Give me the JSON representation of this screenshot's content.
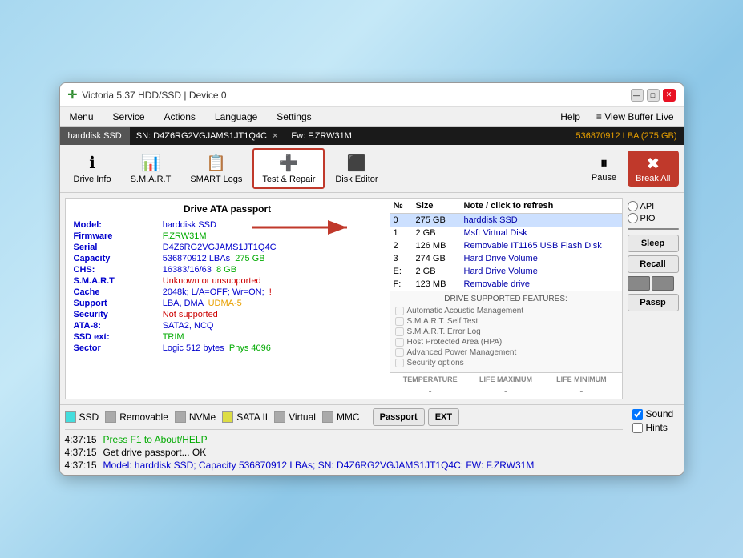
{
  "window": {
    "title": "Victoria 5.37 HDD/SSD | Device 0",
    "icon": "✛"
  },
  "titlebar_controls": {
    "minimize": "—",
    "maximize": "□",
    "close": "✕"
  },
  "menubar": {
    "items": [
      "Menu",
      "Service",
      "Actions",
      "Language",
      "Settings",
      "Help"
    ],
    "right_items": [
      "≡ View Buffer Live"
    ]
  },
  "device_bar": {
    "device_label": "harddisk SSD",
    "sn_label": "SN: D4Z6RG2VGJAMS1JT1Q4C",
    "fw_label": "Fw: F.ZRW31M",
    "lba_label": "536870912 LBA (275 GB)"
  },
  "toolbar": {
    "buttons": [
      {
        "id": "drive-info",
        "icon": "ℹ",
        "label": "Drive Info"
      },
      {
        "id": "smart",
        "icon": "📊",
        "label": "S.M.A.R.T"
      },
      {
        "id": "smart-logs",
        "icon": "📋",
        "label": "SMART Logs"
      },
      {
        "id": "test-repair",
        "icon": "➕",
        "label": "Test & Repair",
        "active": true
      },
      {
        "id": "disk-editor",
        "icon": "⬛",
        "label": "Disk Editor"
      }
    ],
    "pause_label": "Pause",
    "break_label": "Break All"
  },
  "left_panel": {
    "title": "Drive ATA passport",
    "rows": [
      {
        "label": "Model:",
        "value": "harddisk SSD",
        "value_class": "val-blue"
      },
      {
        "label": "Firmware",
        "value": "F.ZRW31M",
        "value_class": "val-green"
      },
      {
        "label": "Serial",
        "value": "D4Z6RG2VGJAMS1JT1Q4C",
        "value_class": "val-blue"
      },
      {
        "label": "Capacity",
        "value": "536870912 LBAs",
        "value_class": "val-blue",
        "extra": "275 GB",
        "extra_class": "val-green"
      },
      {
        "label": "CHS:",
        "value": "16383/16/63",
        "value_class": "val-blue",
        "extra": "8 GB",
        "extra_class": "val-green"
      },
      {
        "label": "S.M.A.R.T",
        "value": "Unknown or unsupported",
        "value_class": "val-red"
      },
      {
        "label": "Cache",
        "value": "2048k; L/A=OFF; Wr=ON;",
        "value_class": "val-blue",
        "extra": "!",
        "extra_class": "val-red"
      },
      {
        "label": "Support",
        "value": "LBA, DMA",
        "value_class": "val-blue",
        "extra": "UDMA-5",
        "extra_class": "val-orange"
      },
      {
        "label": "Security",
        "value": "Not supported",
        "value_class": "val-red"
      },
      {
        "label": "ATA-8:",
        "value": "SATA2, NCQ",
        "value_class": "val-blue"
      },
      {
        "label": "SSD ext:",
        "value": "TRIM",
        "value_class": "val-green"
      },
      {
        "label": "Sector",
        "value": "Logic 512 bytes",
        "value_class": "val-blue",
        "extra": "Phys 4096",
        "extra_class": "val-green"
      }
    ]
  },
  "drive_list": {
    "headers": [
      "№",
      "Size",
      "Note / click to refresh"
    ],
    "rows": [
      {
        "num": "0",
        "size": "275 GB",
        "note": "harddisk SSD",
        "selected": true
      },
      {
        "num": "1",
        "size": "2 GB",
        "note": "Msft   Virtual Disk"
      },
      {
        "num": "2",
        "size": "126 MB",
        "note": "Removable IT1165  USB Flash Disk"
      },
      {
        "num": "3",
        "size": "274 GB",
        "note": "Hard Drive Volume"
      },
      {
        "num": "E:",
        "size": "2 GB",
        "note": "Hard Drive Volume"
      },
      {
        "num": "F:",
        "size": "123 MB",
        "note": "Removable drive"
      }
    ]
  },
  "features": {
    "title": "DRIVE SUPPORTED FEATURES:",
    "items": [
      "Automatic Acoustic Management",
      "S.M.A.R.T. Self Test",
      "S.M.A.R.T. Error Log",
      "Host Protected Area (HPA)",
      "Advanced Power Management",
      "Security options"
    ]
  },
  "temperature": {
    "temp_label": "TEMPERATURE",
    "temp_val": "-",
    "life_max_label": "LIFE MAXIMUM",
    "life_max_val": "-",
    "life_min_label": "LIFE MINIMUM",
    "life_min_val": "-"
  },
  "right_panel": {
    "api_label": "API",
    "pio_label": "PIO",
    "sleep_label": "Sleep",
    "recall_label": "Recall",
    "passp_label": "Passp"
  },
  "bottom_bar": {
    "buttons": [
      {
        "id": "ssd",
        "label": "SSD",
        "color": "#4dd"
      },
      {
        "id": "removable",
        "label": "Removable",
        "color": "#aaa"
      },
      {
        "id": "nvme",
        "label": "NVMe",
        "color": "#aaa"
      },
      {
        "id": "sata2",
        "label": "SATA II",
        "color": "#dd4"
      },
      {
        "id": "virtual",
        "label": "Virtual",
        "color": "#aaa"
      },
      {
        "id": "mmc",
        "label": "MMC",
        "color": "#aaa"
      }
    ],
    "passport_label": "Passport",
    "ext_label": "EXT"
  },
  "log_entries": [
    {
      "time": "4:37:15",
      "msg": "Press F1 to About/HELP",
      "class": "log-msg-green"
    },
    {
      "time": "4:37:15",
      "msg": "Get drive passport... OK",
      "class": "log-msg-normal"
    },
    {
      "time": "4:37:15",
      "msg": "Model: harddisk SSD; Capacity 536870912 LBAs; SN: D4Z6RG2VGJAMS1JT1Q4C; FW: F.ZRW31M",
      "class": "log-msg-blue"
    }
  ],
  "sound": {
    "sound_label": "Sound",
    "hints_label": "Hints"
  }
}
